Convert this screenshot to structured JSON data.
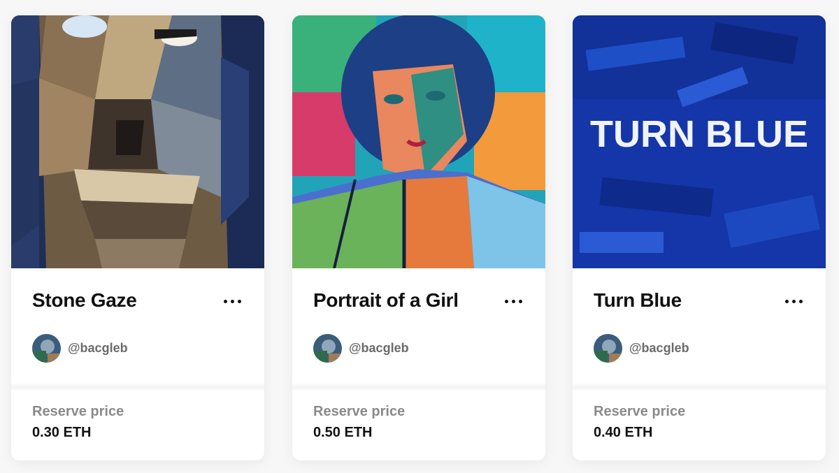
{
  "cards": [
    {
      "title": "Stone Gaze",
      "creator": "@bacgleb",
      "price_label": "Reserve price",
      "price": "0.30 ETH",
      "artwork_icon": "cubist-face-painting",
      "menu_icon": "more-horizontal-icon"
    },
    {
      "title": "Portrait of a Girl",
      "creator": "@bacgleb",
      "price_label": "Reserve price",
      "price": "0.50 ETH",
      "artwork_icon": "fauvist-portrait-painting",
      "menu_icon": "more-horizontal-icon"
    },
    {
      "title": "Turn Blue",
      "creator": "@bacgleb",
      "price_label": "Reserve price",
      "price": "0.40 ETH",
      "artwork_icon": "blue-abstract-painting",
      "artwork_text": "TURN BLUE",
      "menu_icon": "more-horizontal-icon"
    }
  ],
  "colors": {
    "card_background": "#ffffff",
    "page_background": "#f7f7f7",
    "title": "#111111",
    "muted_text": "#8a8a8a"
  }
}
